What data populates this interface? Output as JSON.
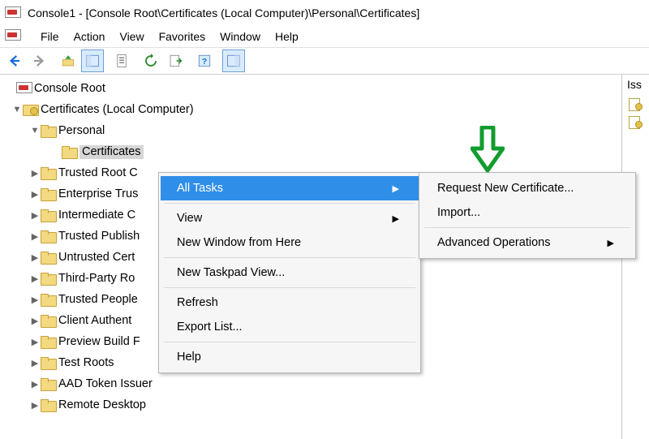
{
  "window": {
    "title": "Console1 - [Console Root\\Certificates (Local Computer)\\Personal\\Certificates]"
  },
  "menu": {
    "file": "File",
    "action": "Action",
    "view": "View",
    "favorites": "Favorites",
    "window": "Window",
    "help": "Help"
  },
  "tree": {
    "root": "Console Root",
    "certs_lc": "Certificates (Local Computer)",
    "personal": "Personal",
    "certificates_node": "Certificates",
    "items": [
      "Trusted Root C",
      "Enterprise Trus",
      "Intermediate C",
      "Trusted Publish",
      "Untrusted Cert",
      "Third-Party Ro",
      "Trusted People",
      "Client Authent",
      "Preview Build F",
      "Test Roots",
      "AAD Token Issuer",
      "Remote Desktop"
    ]
  },
  "context_menu": {
    "all_tasks": "All Tasks",
    "view": "View",
    "new_window": "New Window from Here",
    "new_taskpad": "New Taskpad View...",
    "refresh": "Refresh",
    "export_list": "Export List...",
    "help": "Help"
  },
  "submenu": {
    "request_new": "Request New Certificate...",
    "import": "Import...",
    "advanced": "Advanced Operations"
  },
  "right_pane": {
    "header": "Iss"
  }
}
